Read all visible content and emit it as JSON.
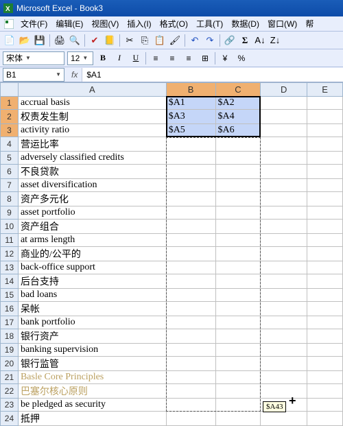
{
  "title": "Microsoft Excel - Book3",
  "menu": [
    "文件(F)",
    "编辑(E)",
    "视图(V)",
    "插入(I)",
    "格式(O)",
    "工具(T)",
    "数据(D)",
    "窗口(W)",
    "帮"
  ],
  "font": {
    "name": "宋体",
    "size": "12"
  },
  "namebox": "B1",
  "formula": "$A1",
  "columns": [
    "A",
    "B",
    "C",
    "D",
    "E"
  ],
  "selected_cols": [
    "B",
    "C"
  ],
  "rows": [
    {
      "n": 1,
      "a": "accrual basis",
      "b": "$A1",
      "c": "$A2",
      "sel": true
    },
    {
      "n": 2,
      "a": "权责发生制",
      "b": "$A3",
      "c": "$A4",
      "sel": true,
      "cn": true
    },
    {
      "n": 3,
      "a": "activity ratio",
      "b": "$A5",
      "c": "$A6",
      "sel": true
    },
    {
      "n": 4,
      "a": "营运比率",
      "cn": true
    },
    {
      "n": 5,
      "a": "adversely classified credits"
    },
    {
      "n": 6,
      "a": "不良贷款",
      "cn": true
    },
    {
      "n": 7,
      "a": "asset diversification"
    },
    {
      "n": 8,
      "a": "资产多元化",
      "cn": true
    },
    {
      "n": 9,
      "a": "asset portfolio"
    },
    {
      "n": 10,
      "a": "资产组合",
      "cn": true
    },
    {
      "n": 11,
      "a": "at arms length"
    },
    {
      "n": 12,
      "a": "商业的/公平的",
      "cn": true
    },
    {
      "n": 13,
      "a": "back-office support"
    },
    {
      "n": 14,
      "a": "后台支持",
      "cn": true
    },
    {
      "n": 15,
      "a": "bad loans"
    },
    {
      "n": 16,
      "a": "呆帐",
      "cn": true
    },
    {
      "n": 17,
      "a": "bank portfolio"
    },
    {
      "n": 18,
      "a": "银行资产",
      "cn": true
    },
    {
      "n": 19,
      "a": "banking supervision"
    },
    {
      "n": 20,
      "a": "银行监管",
      "cn": true
    },
    {
      "n": 21,
      "a": "Basle Core Principles",
      "faded": true
    },
    {
      "n": 22,
      "a": "巴塞尔核心原则",
      "cn": true,
      "faded": true
    },
    {
      "n": 23,
      "a": "be pledged as security"
    },
    {
      "n": 24,
      "a": "抵押",
      "cn": true
    }
  ],
  "tooltip": "$A43"
}
